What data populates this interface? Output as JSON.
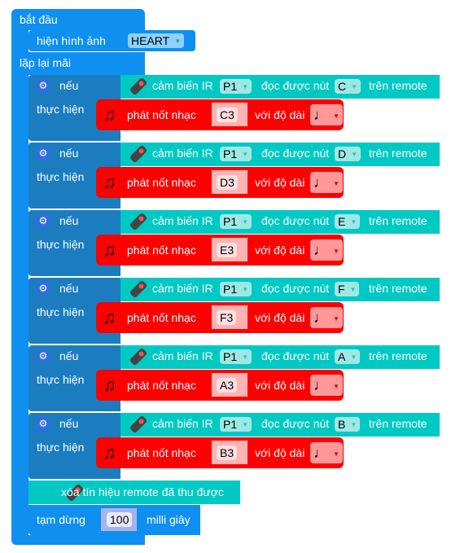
{
  "start": {
    "label": "bắt đầu",
    "show_image_label": "hiện hình ảnh",
    "image_value": "HEART"
  },
  "loop": {
    "label": "lặp lại mãi"
  },
  "if_label": "nếu",
  "then_label": "thực hiện",
  "condition": {
    "prefix": "cảm biến IR",
    "middle": "đọc được nút",
    "suffix": "trên remote"
  },
  "play": {
    "label": "phát nốt nhạc",
    "duration_label": "với độ dài"
  },
  "rules": [
    {
      "pin": "P1",
      "button": "C",
      "note": "C3"
    },
    {
      "pin": "P1",
      "button": "D",
      "note": "D3"
    },
    {
      "pin": "P1",
      "button": "E",
      "note": "E3"
    },
    {
      "pin": "P1",
      "button": "F",
      "note": "F3"
    },
    {
      "pin": "P1",
      "button": "A",
      "note": "A3"
    },
    {
      "pin": "P1",
      "button": "B",
      "note": "B3"
    }
  ],
  "clear": {
    "label": "xóa tín hiệu remote đã thu được"
  },
  "pause": {
    "label": "tạm dừng",
    "value": "100",
    "unit": "milli giây"
  },
  "colors": {
    "main": "#0f8ff0",
    "if": "#1b7dc0",
    "sensor": "#00c9c4",
    "music": "#ff0000"
  }
}
